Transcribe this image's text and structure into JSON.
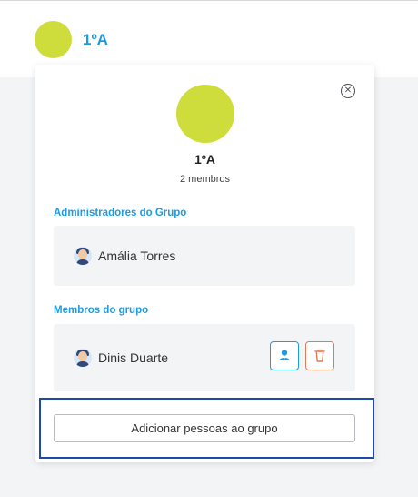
{
  "header": {
    "group_name": "1ºA"
  },
  "card": {
    "group_name": "1ºA",
    "member_count": "2 membros",
    "admins_title": "Administradores do Grupo",
    "admins": [
      {
        "name": "Amália Torres"
      }
    ],
    "members_title": "Membros do grupo",
    "members": [
      {
        "name": "Dinis Duarte"
      }
    ],
    "add_button_label": "Adicionar pessoas ao grupo"
  },
  "colors": {
    "accent": "#1d9be0",
    "avatar": "#cfdd3c",
    "delete": "#e07a56",
    "focus": "#1f4aa8"
  },
  "icons": {
    "close": "close-circle-icon",
    "admin": "user-admin-icon",
    "delete": "trash-icon"
  }
}
